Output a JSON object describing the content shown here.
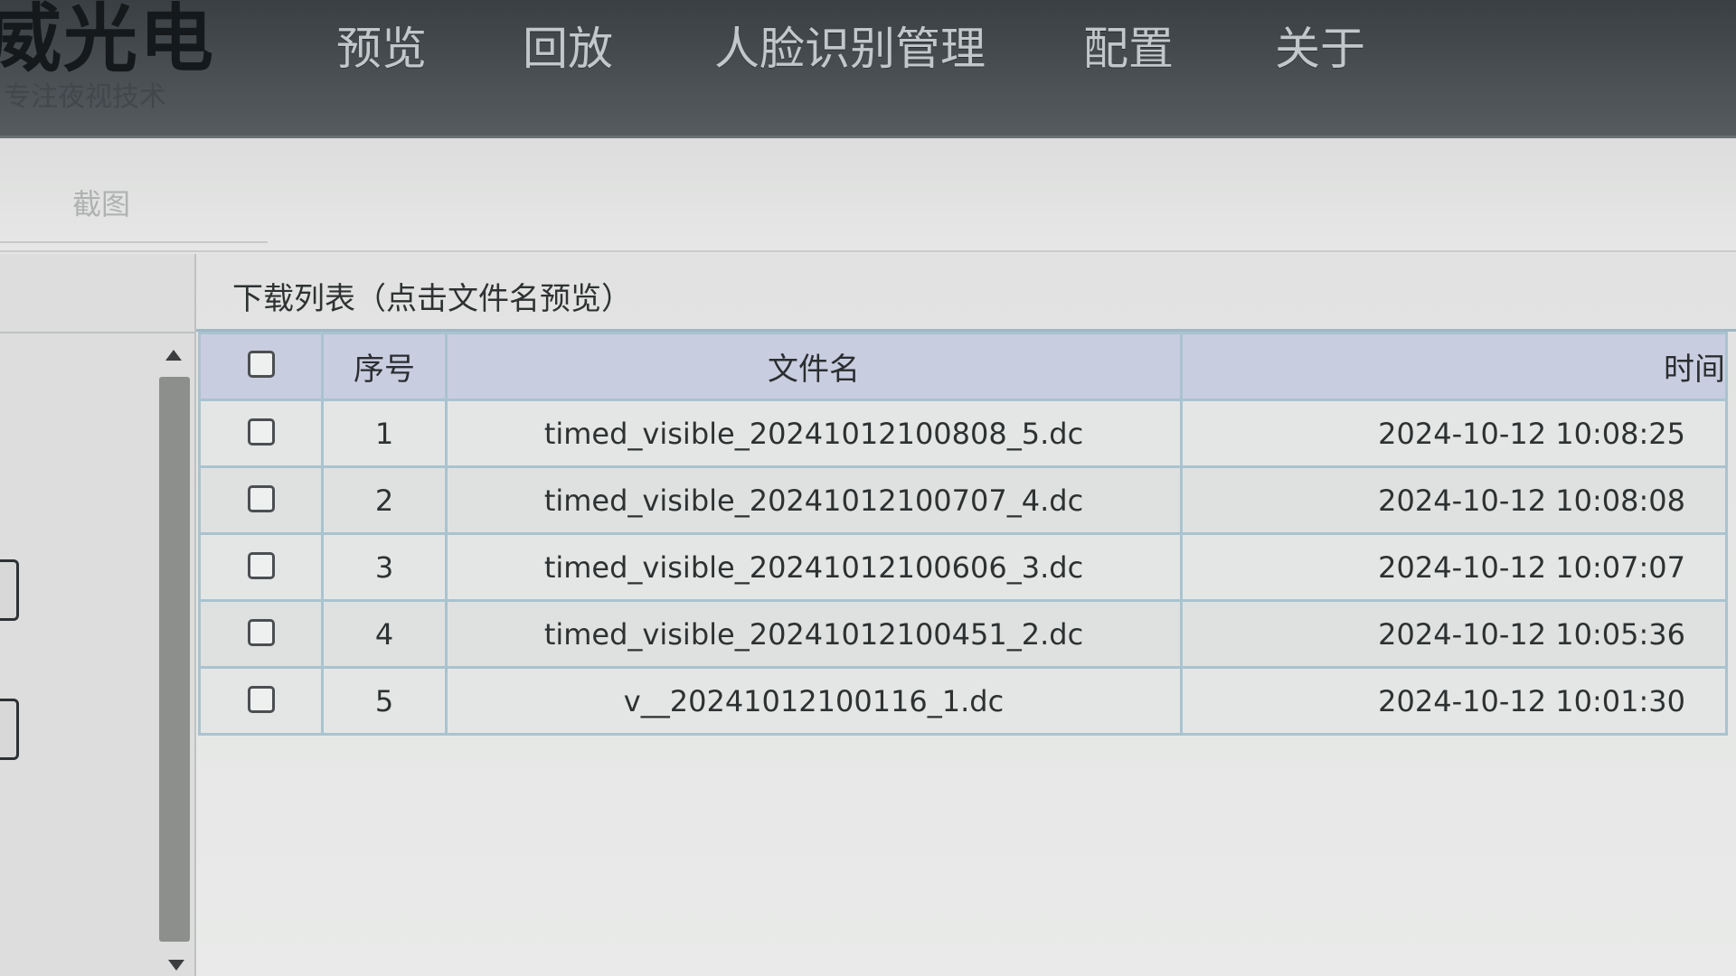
{
  "header": {
    "logo_text": "威光电",
    "logo_subtitle": "专注夜视技术",
    "nav": [
      "预览",
      "回放",
      "人脸识别管理",
      "配置",
      "关于"
    ]
  },
  "page_tab": "截图",
  "download_list": {
    "title": "下载列表（点击文件名预览）",
    "columns": {
      "index": "序号",
      "filename": "文件名",
      "time": "时间"
    },
    "rows": [
      {
        "index": "1",
        "filename": "timed_visible_20241012100808_5.dc",
        "time": "2024-10-12 10:08:25"
      },
      {
        "index": "2",
        "filename": "timed_visible_20241012100707_4.dc",
        "time": "2024-10-12 10:08:08"
      },
      {
        "index": "3",
        "filename": "timed_visible_20241012100606_3.dc",
        "time": "2024-10-12 10:07:07"
      },
      {
        "index": "4",
        "filename": "timed_visible_20241012100451_2.dc",
        "time": "2024-10-12 10:05:36"
      },
      {
        "index": "5",
        "filename": "v__20241012100116_1.dc",
        "time": "2024-10-12 10:01:30"
      }
    ]
  },
  "icons": {
    "scroll_up": "triangle-up-icon",
    "scroll_down": "triangle-down-icon",
    "checkbox": "checkbox-unchecked-icon"
  },
  "colors": {
    "topbar": "#4a5054",
    "nav_text": "#c2c7cb",
    "table_header_bg": "#c9cde0",
    "table_border": "#a9c3d0",
    "page_bg": "#e4e5e4"
  }
}
